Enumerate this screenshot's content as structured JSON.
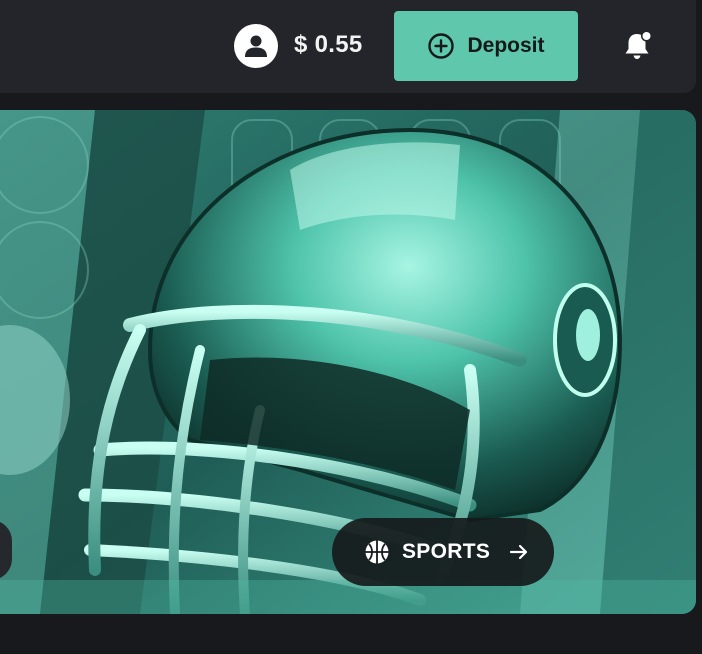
{
  "header": {
    "balance": "$ 0.55",
    "deposit_label": "Deposit",
    "avatar_icon": "user-icon",
    "deposit_icon": "plus-circle-icon",
    "notification_icon": "bell-icon",
    "accent_color": "#5ec7ac"
  },
  "banner": {
    "category_label": "SPORTS",
    "category_icon": "basketball-icon",
    "arrow_icon": "arrow-right-icon",
    "image": "football-helmet-illustration"
  }
}
